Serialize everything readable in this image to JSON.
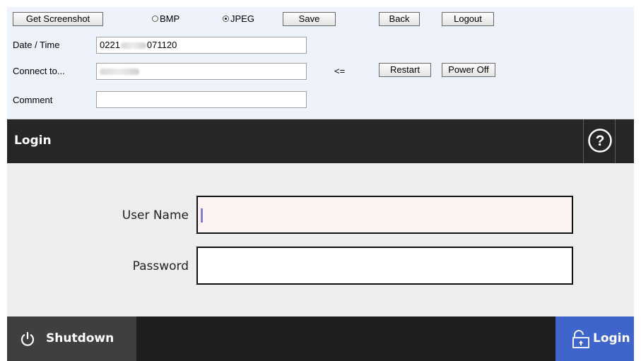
{
  "toolbar": {
    "get_screenshot_label": "Get Screenshot",
    "format_bmp_label": "BMP",
    "format_jpeg_label": "JPEG",
    "selected_format": "JPEG",
    "save_label": "Save",
    "back_label": "Back",
    "logout_label": "Logout"
  },
  "fields": {
    "date_time_label": "Date / Time",
    "date_time_prefix": "0221",
    "date_time_suffix": "071120",
    "connect_to_label": "Connect to...",
    "arrow_text": "<=",
    "restart_label": "Restart",
    "power_off_label": "Power Off",
    "comment_label": "Comment",
    "comment_value": ""
  },
  "header": {
    "title": "Login",
    "help_icon": "question-circle-icon"
  },
  "login_form": {
    "username_label": "User Name",
    "username_value": "",
    "password_label": "Password",
    "password_value": ""
  },
  "bottom_bar": {
    "shutdown_label": "Shutdown",
    "shutdown_icon": "power-icon",
    "login_label": "Login",
    "login_icon": "unlock-icon"
  },
  "colors": {
    "panel_bg": "#eef3fb",
    "header_bg": "#262626",
    "main_bg": "#eeeeee",
    "login_accent": "#3f64cc",
    "shutdown_bg": "#3f3f3f"
  }
}
